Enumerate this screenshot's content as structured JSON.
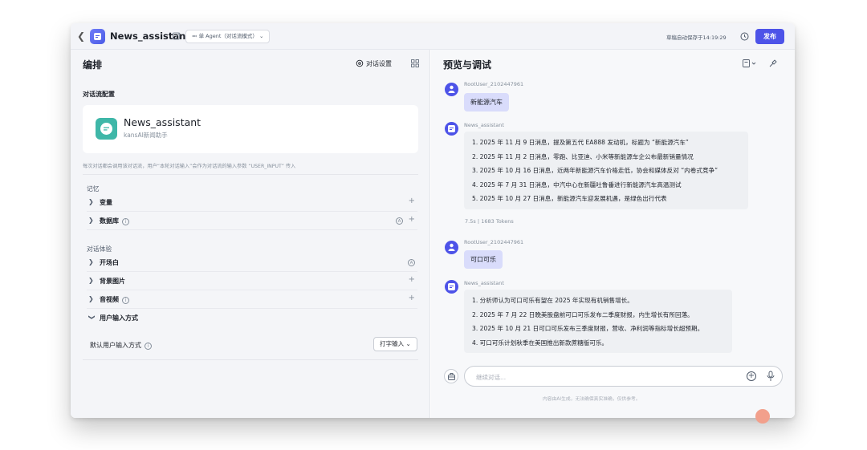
{
  "topbar": {
    "app_name": "News_assistant",
    "mode": "单 Agent（对话流模式）",
    "autosave": "草稿自动保存于14:19:29",
    "publish_label": "发布"
  },
  "left": {
    "title": "编排",
    "conv_settings_label": "对话设置",
    "section_title": "对话流配置",
    "agent_card": {
      "name": "News_assistant",
      "desc": "kansAI新闻助手"
    },
    "hint": "每次对话都会调用该对话流，用户“本轮对话输入”会作为对话流的输入参数 “USER_INPUT” 传入",
    "memory_label": "记忆",
    "memory_rows": [
      {
        "label": "变量",
        "has_info": false
      },
      {
        "label": "数据库",
        "has_info": true
      }
    ],
    "experience_label": "对话体验",
    "experience_rows": [
      {
        "label": "开场白",
        "has_info": false
      },
      {
        "label": "背景图片",
        "has_info": false
      },
      {
        "label": "音视频",
        "has_info": true
      },
      {
        "label": "用户输入方式",
        "has_info": false
      }
    ],
    "default_input_label": "默认用户输入方式",
    "default_input_value": "打字输入"
  },
  "right": {
    "title": "预览与调试",
    "messages": [
      {
        "role": "user",
        "sender": "RootUser_2102447961",
        "text": "新能源汽车"
      },
      {
        "role": "bot",
        "sender": "News_assistant",
        "lines": [
          "1. 2025 年 11 月 9 日消息，提及第五代 EA888 发动机，标题为 “新能源汽车”",
          "2. 2025 年 11 月 2 日消息，零跑、比亚迪、小米等新能源车企公布最新销量情况",
          "3. 2025 年 10 月 16 日消息，近两年新能源汽车价格走低，协会和媒体反对 “内卷式竞争”",
          "4. 2025 年 7 月 31 日消息，中汽中心在新疆吐鲁番进行新能源汽车高温测试",
          "5. 2025 年 10 月 27 日消息，新能源汽车迎发展机遇，是绿色出行代表"
        ],
        "stats": "7.5s丨1683 Tokens"
      },
      {
        "role": "user",
        "sender": "RootUser_2102447961",
        "text": "可口可乐"
      },
      {
        "role": "bot",
        "sender": "News_assistant",
        "lines": [
          "1. 分析师认为可口可乐有望在 2025 年实现有机销售增长。",
          "2. 2025 年 7 月 22 日晚美股盘前可口可乐发布二季度财报，内生增长有所回落。",
          "3. 2025 年 10 月 21 日可口可乐发布三季度财报，营收、净利润等指标增长超预期。",
          "4. 可口可乐计划秋季在美国推出新款蔗糖版可乐。"
        ]
      }
    ],
    "input_placeholder": "继续对话...",
    "disclaimer": "内容由AI生成，无法确保真实准确，仅供参考。"
  }
}
